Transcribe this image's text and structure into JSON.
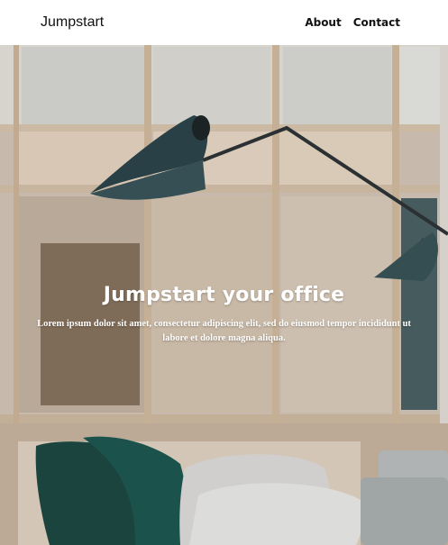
{
  "navbar": {
    "brand": "Jumpstart",
    "links": [
      "About",
      "Contact"
    ]
  },
  "hero": {
    "title": "Jumpstart your office",
    "subtitle": "Lorem ipsum dolor sit amet, consectetur adipiscing elit, sed do eiusmod tempor incididunt ut labore et dolore magna aliqua."
  }
}
